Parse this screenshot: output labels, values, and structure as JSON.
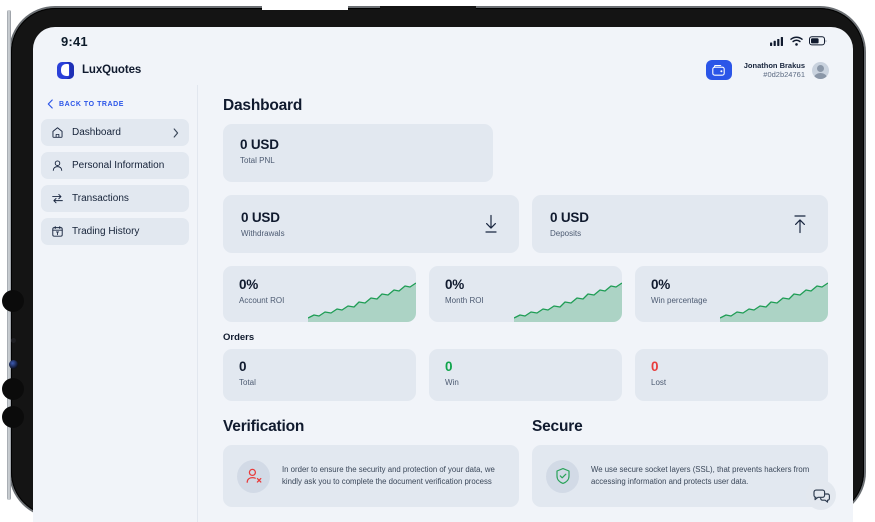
{
  "status_bar": {
    "time": "9:41",
    "icons": [
      "cellular-signal-icon",
      "wifi-icon",
      "battery-icon"
    ]
  },
  "header": {
    "brand_name": "LuxQuotes",
    "brand_icon": "luxquotes-logo-icon",
    "wallet_button_icon": "wallet-icon",
    "user_name": "Jonathon Brakus",
    "user_id": "#0d2b24761",
    "avatar_icon": "user-avatar-icon"
  },
  "sidebar": {
    "back_label": "BACK TO TRADE",
    "back_icon": "chevron-left-icon",
    "items": [
      {
        "label": "Dashboard",
        "icon": "home-icon",
        "active": true,
        "chevron": "chevron-right-icon"
      },
      {
        "label": "Personal Information",
        "icon": "user-icon",
        "active": false
      },
      {
        "label": "Transactions",
        "icon": "transfer-arrows-icon",
        "active": false
      },
      {
        "label": "Trading History",
        "icon": "calendar-icon",
        "active": false
      }
    ]
  },
  "main": {
    "page_title": "Dashboard",
    "total_pnl": {
      "value": "0 USD",
      "label": "Total PNL"
    },
    "money_cards": [
      {
        "value": "0 USD",
        "label": "Withdrawals",
        "icon": "download-arrow-icon"
      },
      {
        "value": "0 USD",
        "label": "Deposits",
        "icon": "upload-arrow-icon"
      }
    ],
    "roi_cards": [
      {
        "value": "0%",
        "label": "Account ROI"
      },
      {
        "value": "0%",
        "label": "Month ROI"
      },
      {
        "value": "0%",
        "label": "Win percentage"
      }
    ],
    "orders": {
      "title": "Orders",
      "cards": [
        {
          "value": "0",
          "label": "Total",
          "color": "#101a2e"
        },
        {
          "value": "0",
          "label": "Win",
          "color": "#0fa44b"
        },
        {
          "value": "0",
          "label": "Lost",
          "color": "#e83c3c"
        }
      ]
    },
    "verification": {
      "title": "Verification",
      "icon": "user-unverified-icon",
      "text": "In order to ensure the security and protection of your data, we kindly ask you to complete the document verification process"
    },
    "secure": {
      "title": "Secure",
      "icon": "shield-check-icon",
      "text": "We use secure socket layers (SSL), that prevents hackers from accessing information and protects user data."
    }
  },
  "chat": {
    "icon": "chat-bubbles-icon"
  },
  "colors": {
    "accent": "#2b55e8",
    "card_bg": "#e2e8f0",
    "page_bg": "#f1f4f9",
    "success": "#0fa44b",
    "danger": "#e83c3c",
    "spark_line": "#1f9d55"
  },
  "chart_data": {
    "type": "area",
    "title": "ROI sparkline",
    "series": [
      {
        "name": "Account ROI",
        "values": [
          2,
          4,
          3,
          6,
          5,
          8,
          7,
          10,
          9,
          13,
          12,
          16,
          15,
          19,
          18,
          22,
          21,
          26,
          25,
          30
        ]
      },
      {
        "name": "Month ROI",
        "values": [
          2,
          4,
          3,
          6,
          5,
          8,
          7,
          10,
          9,
          13,
          12,
          16,
          15,
          19,
          18,
          22,
          21,
          26,
          25,
          30
        ]
      },
      {
        "name": "Win percentage",
        "values": [
          2,
          4,
          3,
          6,
          5,
          8,
          7,
          10,
          9,
          13,
          12,
          16,
          15,
          19,
          18,
          22,
          21,
          26,
          25,
          30
        ]
      }
    ],
    "grid": false,
    "legend": "none",
    "ylim": [
      0,
      32
    ]
  }
}
